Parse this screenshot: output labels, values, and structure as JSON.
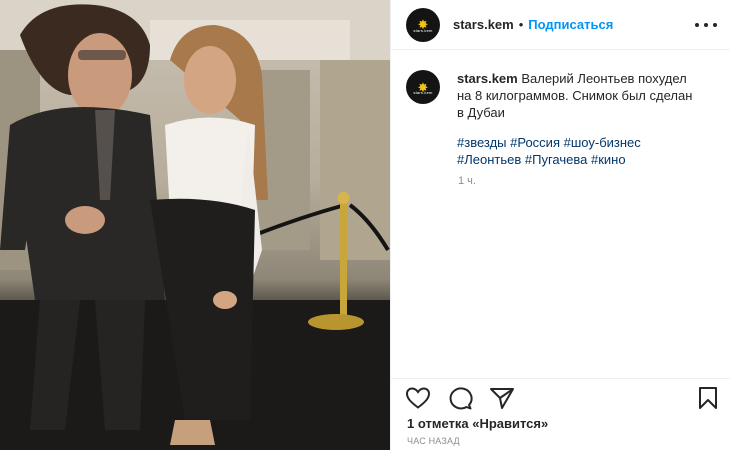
{
  "post": {
    "username": "stars.kem",
    "follow_label": "Подписаться",
    "separator": "•",
    "caption": "Валерий Леонтьев похудел на 8 килограммов. Снимок был сделан в Дубаи",
    "hashtags": [
      "#звезды",
      "#Россия",
      "#шоу-бизнес",
      "#Леонтьев",
      "#Пугачева",
      "#кино"
    ],
    "time_short": "1 ч.",
    "likes": "1 отметка «Нравится»",
    "time_ago": "ЧАС НАЗАД"
  },
  "icons": {
    "like": "heart-outline-icon",
    "comment": "comment-bubble-icon",
    "share": "paper-plane-icon",
    "save": "bookmark-icon",
    "more": "ellipsis-icon"
  },
  "colors": {
    "link": "#0095f6",
    "hashtag": "#00376b",
    "muted": "#8e8e8e",
    "avatar_bg": "#141414",
    "avatar_star": "#f0c419"
  }
}
